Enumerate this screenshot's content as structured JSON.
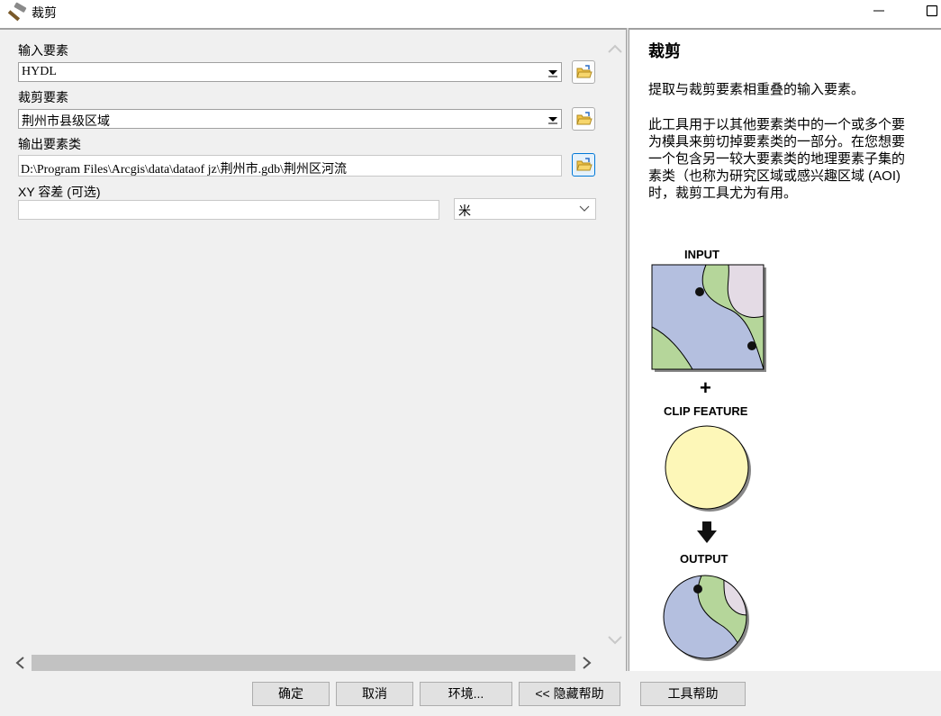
{
  "window": {
    "title": "裁剪",
    "icon": "hammer-icon",
    "controls": [
      "minimize-icon",
      "maximize-icon"
    ]
  },
  "params": {
    "input_features": {
      "label": "输入要素",
      "value": "HYDL"
    },
    "clip_features": {
      "label": "裁剪要素",
      "value": "荆州市县级区域"
    },
    "output_feature_class": {
      "label": "输出要素类",
      "value": "D:\\Program Files\\Arcgis\\data\\dataof jz\\荆州市.gdb\\荆州区河流"
    },
    "xy_tolerance": {
      "label": "XY 容差 (可选)",
      "value": "",
      "unit": "米"
    },
    "browse_icon": "open-folder-icon"
  },
  "help": {
    "title": "裁剪",
    "summary": "提取与裁剪要素相重叠的输入要素。",
    "description_lines": [
      "此工具用于以其他要素类中的一个或多个要",
      "为模具来剪切掉要素类的一部分。在您想要",
      "一个包含另一较大要素类的地理要素子集的",
      "素类（也称为研究区域或感兴趣区域 (AOI)",
      "时，裁剪工具尤为有用。"
    ],
    "diagram": {
      "input_label": "INPUT",
      "plus": "+",
      "clip_label": "CLIP FEATURE",
      "output_label": "OUTPUT"
    }
  },
  "buttons": {
    "ok": "确定",
    "cancel": "取消",
    "environments": "环境...",
    "hide_help": "<< 隐藏帮助",
    "tool_help": "工具帮助"
  },
  "colors": {
    "help_bg": "#ffffff",
    "panel_bg": "#f0f0f0",
    "map_green": "#b5d69a",
    "map_blue": "#b4bfdf",
    "map_pink": "#e4dbe5",
    "clip_yellow": "#fdf7b8"
  }
}
